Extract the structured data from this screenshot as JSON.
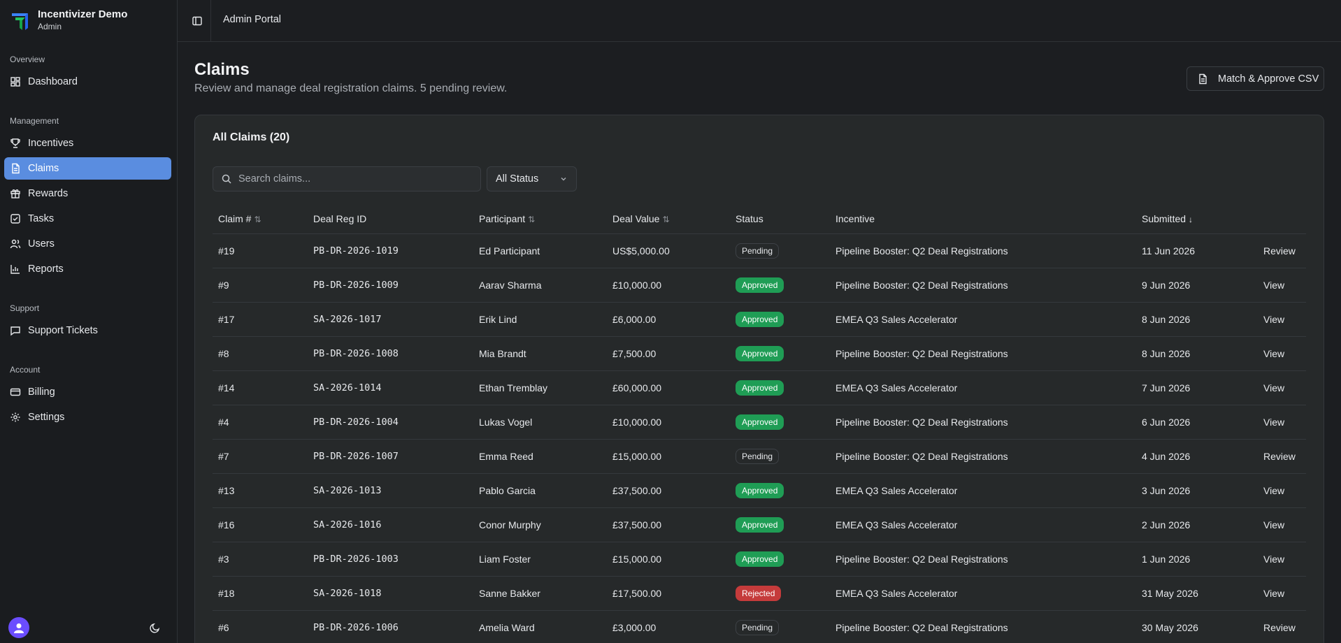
{
  "brand": {
    "name": "Incentivizer Demo",
    "role": "Admin"
  },
  "sidebar": {
    "sections": [
      {
        "label": "Overview",
        "items": [
          {
            "label": "Dashboard",
            "icon": "dashboard-icon"
          }
        ]
      },
      {
        "label": "Management",
        "items": [
          {
            "label": "Incentives",
            "icon": "trophy-icon"
          },
          {
            "label": "Claims",
            "icon": "file-icon",
            "active": true
          },
          {
            "label": "Rewards",
            "icon": "gift-icon"
          },
          {
            "label": "Tasks",
            "icon": "checkbox-icon"
          },
          {
            "label": "Users",
            "icon": "users-icon"
          },
          {
            "label": "Reports",
            "icon": "bar-chart-icon"
          }
        ]
      },
      {
        "label": "Support",
        "items": [
          {
            "label": "Support Tickets",
            "icon": "message-icon"
          }
        ]
      },
      {
        "label": "Account",
        "items": [
          {
            "label": "Billing",
            "icon": "credit-card-icon"
          },
          {
            "label": "Settings",
            "icon": "gear-icon"
          }
        ]
      }
    ]
  },
  "topbar": {
    "title": "Admin Portal"
  },
  "page": {
    "title": "Claims",
    "subtitle": "Review and manage deal registration claims. 5 pending review.",
    "csv_button": "Match & Approve CSV"
  },
  "card": {
    "title": "All Claims (20)",
    "search_placeholder": "Search claims...",
    "status_filter": "All Status"
  },
  "table": {
    "headers": {
      "claim": "Claim #",
      "deal_reg": "Deal Reg ID",
      "participant": "Participant",
      "deal_value": "Deal Value",
      "status": "Status",
      "incentive": "Incentive",
      "submitted": "Submitted"
    },
    "rows": [
      {
        "claim": "#19",
        "deal_reg": "PB-DR-2026-1019",
        "participant": "Ed Participant",
        "value": "US$5,000.00",
        "status": "Pending",
        "incentive": "Pipeline Booster: Q2 Deal Registrations",
        "submitted": "11 Jun 2026",
        "action": "Review"
      },
      {
        "claim": "#9",
        "deal_reg": "PB-DR-2026-1009",
        "participant": "Aarav Sharma",
        "value": "£10,000.00",
        "status": "Approved",
        "incentive": "Pipeline Booster: Q2 Deal Registrations",
        "submitted": "9 Jun 2026",
        "action": "View"
      },
      {
        "claim": "#17",
        "deal_reg": "SA-2026-1017",
        "participant": "Erik Lind",
        "value": "£6,000.00",
        "status": "Approved",
        "incentive": "EMEA Q3 Sales Accelerator",
        "submitted": "8 Jun 2026",
        "action": "View"
      },
      {
        "claim": "#8",
        "deal_reg": "PB-DR-2026-1008",
        "participant": "Mia Brandt",
        "value": "£7,500.00",
        "status": "Approved",
        "incentive": "Pipeline Booster: Q2 Deal Registrations",
        "submitted": "8 Jun 2026",
        "action": "View"
      },
      {
        "claim": "#14",
        "deal_reg": "SA-2026-1014",
        "participant": "Ethan Tremblay",
        "value": "£60,000.00",
        "status": "Approved",
        "incentive": "EMEA Q3 Sales Accelerator",
        "submitted": "7 Jun 2026",
        "action": "View"
      },
      {
        "claim": "#4",
        "deal_reg": "PB-DR-2026-1004",
        "participant": "Lukas Vogel",
        "value": "£10,000.00",
        "status": "Approved",
        "incentive": "Pipeline Booster: Q2 Deal Registrations",
        "submitted": "6 Jun 2026",
        "action": "View"
      },
      {
        "claim": "#7",
        "deal_reg": "PB-DR-2026-1007",
        "participant": "Emma Reed",
        "value": "£15,000.00",
        "status": "Pending",
        "incentive": "Pipeline Booster: Q2 Deal Registrations",
        "submitted": "4 Jun 2026",
        "action": "Review"
      },
      {
        "claim": "#13",
        "deal_reg": "SA-2026-1013",
        "participant": "Pablo Garcia",
        "value": "£37,500.00",
        "status": "Approved",
        "incentive": "EMEA Q3 Sales Accelerator",
        "submitted": "3 Jun 2026",
        "action": "View"
      },
      {
        "claim": "#16",
        "deal_reg": "SA-2026-1016",
        "participant": "Conor Murphy",
        "value": "£37,500.00",
        "status": "Approved",
        "incentive": "EMEA Q3 Sales Accelerator",
        "submitted": "2 Jun 2026",
        "action": "View"
      },
      {
        "claim": "#3",
        "deal_reg": "PB-DR-2026-1003",
        "participant": "Liam Foster",
        "value": "£15,000.00",
        "status": "Approved",
        "incentive": "Pipeline Booster: Q2 Deal Registrations",
        "submitted": "1 Jun 2026",
        "action": "View"
      },
      {
        "claim": "#18",
        "deal_reg": "SA-2026-1018",
        "participant": "Sanne Bakker",
        "value": "£17,500.00",
        "status": "Rejected",
        "incentive": "EMEA Q3 Sales Accelerator",
        "submitted": "31 May 2026",
        "action": "View"
      },
      {
        "claim": "#6",
        "deal_reg": "PB-DR-2026-1006",
        "participant": "Amelia Ward",
        "value": "£3,000.00",
        "status": "Pending",
        "incentive": "Pipeline Booster: Q2 Deal Registrations",
        "submitted": "30 May 2026",
        "action": "Review"
      }
    ]
  },
  "colors": {
    "accent": "#5a8de0",
    "approved": "#1f9d55",
    "rejected": "#c53b3b",
    "background": "#1c1e21"
  }
}
